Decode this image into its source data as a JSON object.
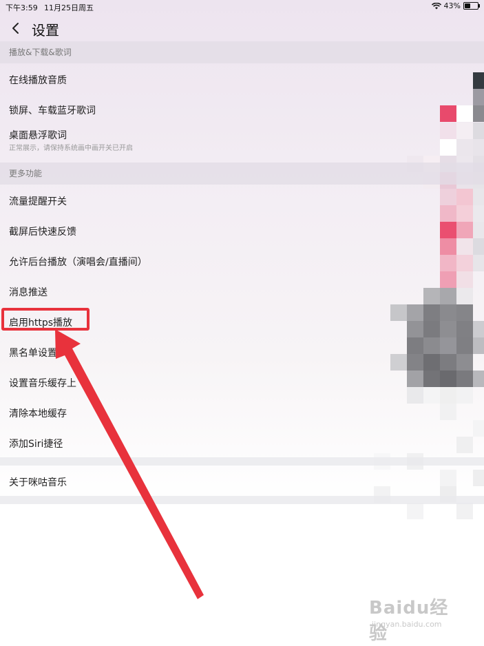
{
  "status_bar": {
    "time": "下午3:59",
    "date": "11月25日周五",
    "battery": "43%",
    "battery_level": 0.43
  },
  "nav": {
    "title": "设置"
  },
  "sections": {
    "playback": {
      "header": "播放&下载&歌词"
    },
    "more": {
      "header": "更多功能"
    }
  },
  "items": {
    "online_quality": "在线播放音质",
    "lockscreen_lyrics": "锁屏、车载蓝牙歌词",
    "desktop_lyrics": "桌面悬浮歌词",
    "desktop_lyrics_sub": "正常展示，请保持系统画中画开关已开启",
    "data_reminder": "流量提醒开关",
    "screenshot_feedback": "截屏后快速反馈",
    "background_play": "允许后台播放（演唱会/直播间）",
    "push": "消息推送",
    "https": "启用https播放",
    "blacklist": "黑名单设置",
    "cache_limit": "设置音乐缓存上",
    "clear_cache": "清除本地缓存",
    "siri": "添加Siri捷径",
    "about": "关于咪咕音乐"
  },
  "annotation": {
    "box_color": "#e8323c",
    "arrow_color": "#e8323c"
  },
  "watermark": {
    "brand": "Baidu经验",
    "url": "jingyan.baidu.com"
  }
}
